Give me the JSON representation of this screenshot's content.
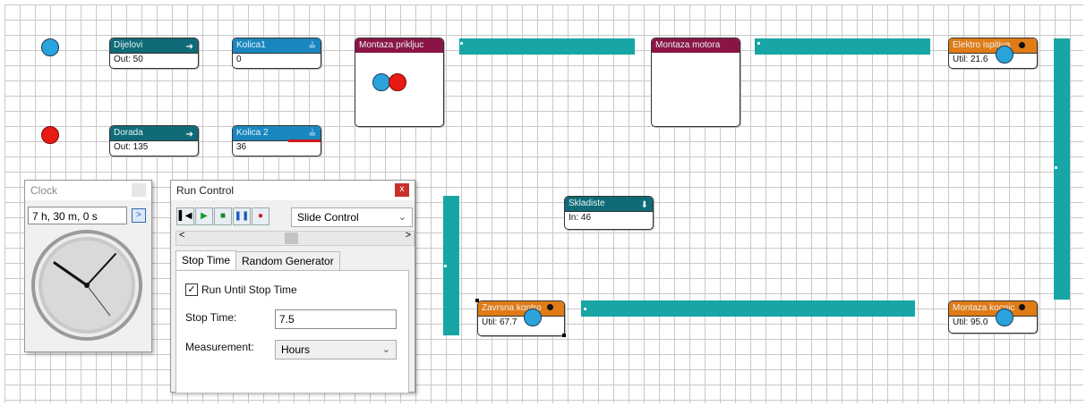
{
  "blocks": {
    "dijelovi": {
      "title": "Dijelovi",
      "value": "Out: 50"
    },
    "kolica1": {
      "title": "Kolica1",
      "value": "0"
    },
    "dorada": {
      "title": "Dorada",
      "value": "Out: 135"
    },
    "kolica2": {
      "title": "Kolica 2",
      "value": "36"
    },
    "montaza_prikljuc": {
      "title": "Montaza prikljuc"
    },
    "montaza_motora": {
      "title": "Montaza motora"
    },
    "elektro": {
      "title": "Elektro ispitiva",
      "value": "Util: 21.6"
    },
    "skladiste": {
      "title": "Skladiste",
      "value": "In: 46"
    },
    "zavrsna": {
      "title": "Zavrsna kontro",
      "value": "Util: 67.7"
    },
    "montaza_kocnica": {
      "title": "Montaza kocnic",
      "value": "Util: 95.0"
    }
  },
  "clock": {
    "title": "Clock",
    "time": "7 h, 30 m, 0 s",
    "go_label": ">"
  },
  "run_control": {
    "title": "Run Control",
    "close_label": "x",
    "speed_select": "Slide Control",
    "scroll_left": "<",
    "scroll_right": ">",
    "tabs": [
      {
        "label": "Stop Time"
      },
      {
        "label": "Random Generator"
      }
    ],
    "run_until_label": "Run Until Stop Time",
    "stop_time_label": "Stop Time:",
    "stop_time_value": "7.5",
    "measurement_label": "Measurement:",
    "measurement_value": "Hours"
  },
  "colors": {
    "conveyor": "#17a5a5",
    "teal_header": "#0f6b77",
    "blue_header": "#1a86c0",
    "maroon_header": "#8b1446",
    "orange_header": "#e07b16"
  }
}
